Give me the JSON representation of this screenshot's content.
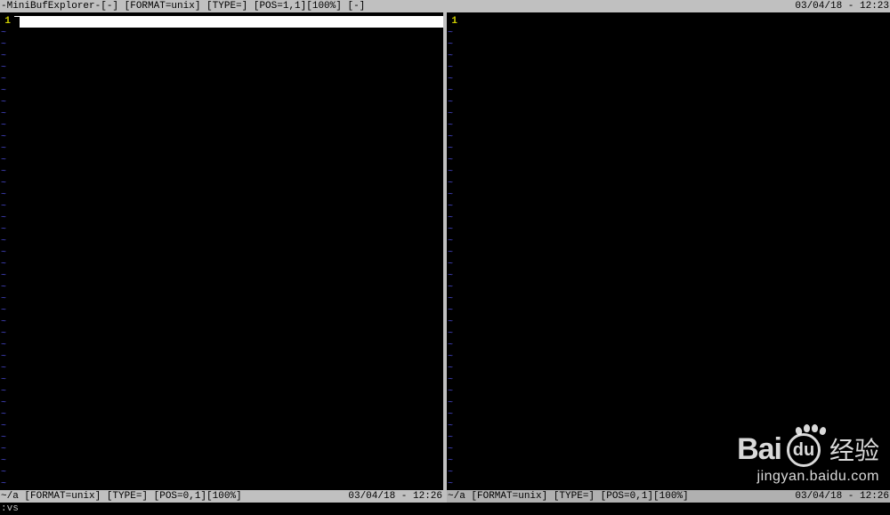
{
  "topbar": {
    "left": "-MiniBufExplorer-[-] [FORMAT=unix] [TYPE=] [POS=1,1][100%] [-]",
    "right": "03/04/18 - 12:23"
  },
  "panes": {
    "left": {
      "linenum": "1",
      "tilde": "~"
    },
    "right": {
      "linenum": "1",
      "tilde": "~"
    }
  },
  "bottombar": {
    "left": {
      "path": "~/a [FORMAT=unix] [TYPE=] [POS=0,1][100%]",
      "time": "03/04/18 - 12:26"
    },
    "right": {
      "path": "~/a [FORMAT=unix] [TYPE=] [POS=0,1][100%]",
      "time": "03/04/18 - 12:26"
    }
  },
  "cmdline": ":vs",
  "watermark": {
    "brand_a": "Bai",
    "brand_b": "du",
    "brand_c": "经验",
    "url": "jingyan.baidu.com"
  },
  "tilde_count": 40
}
